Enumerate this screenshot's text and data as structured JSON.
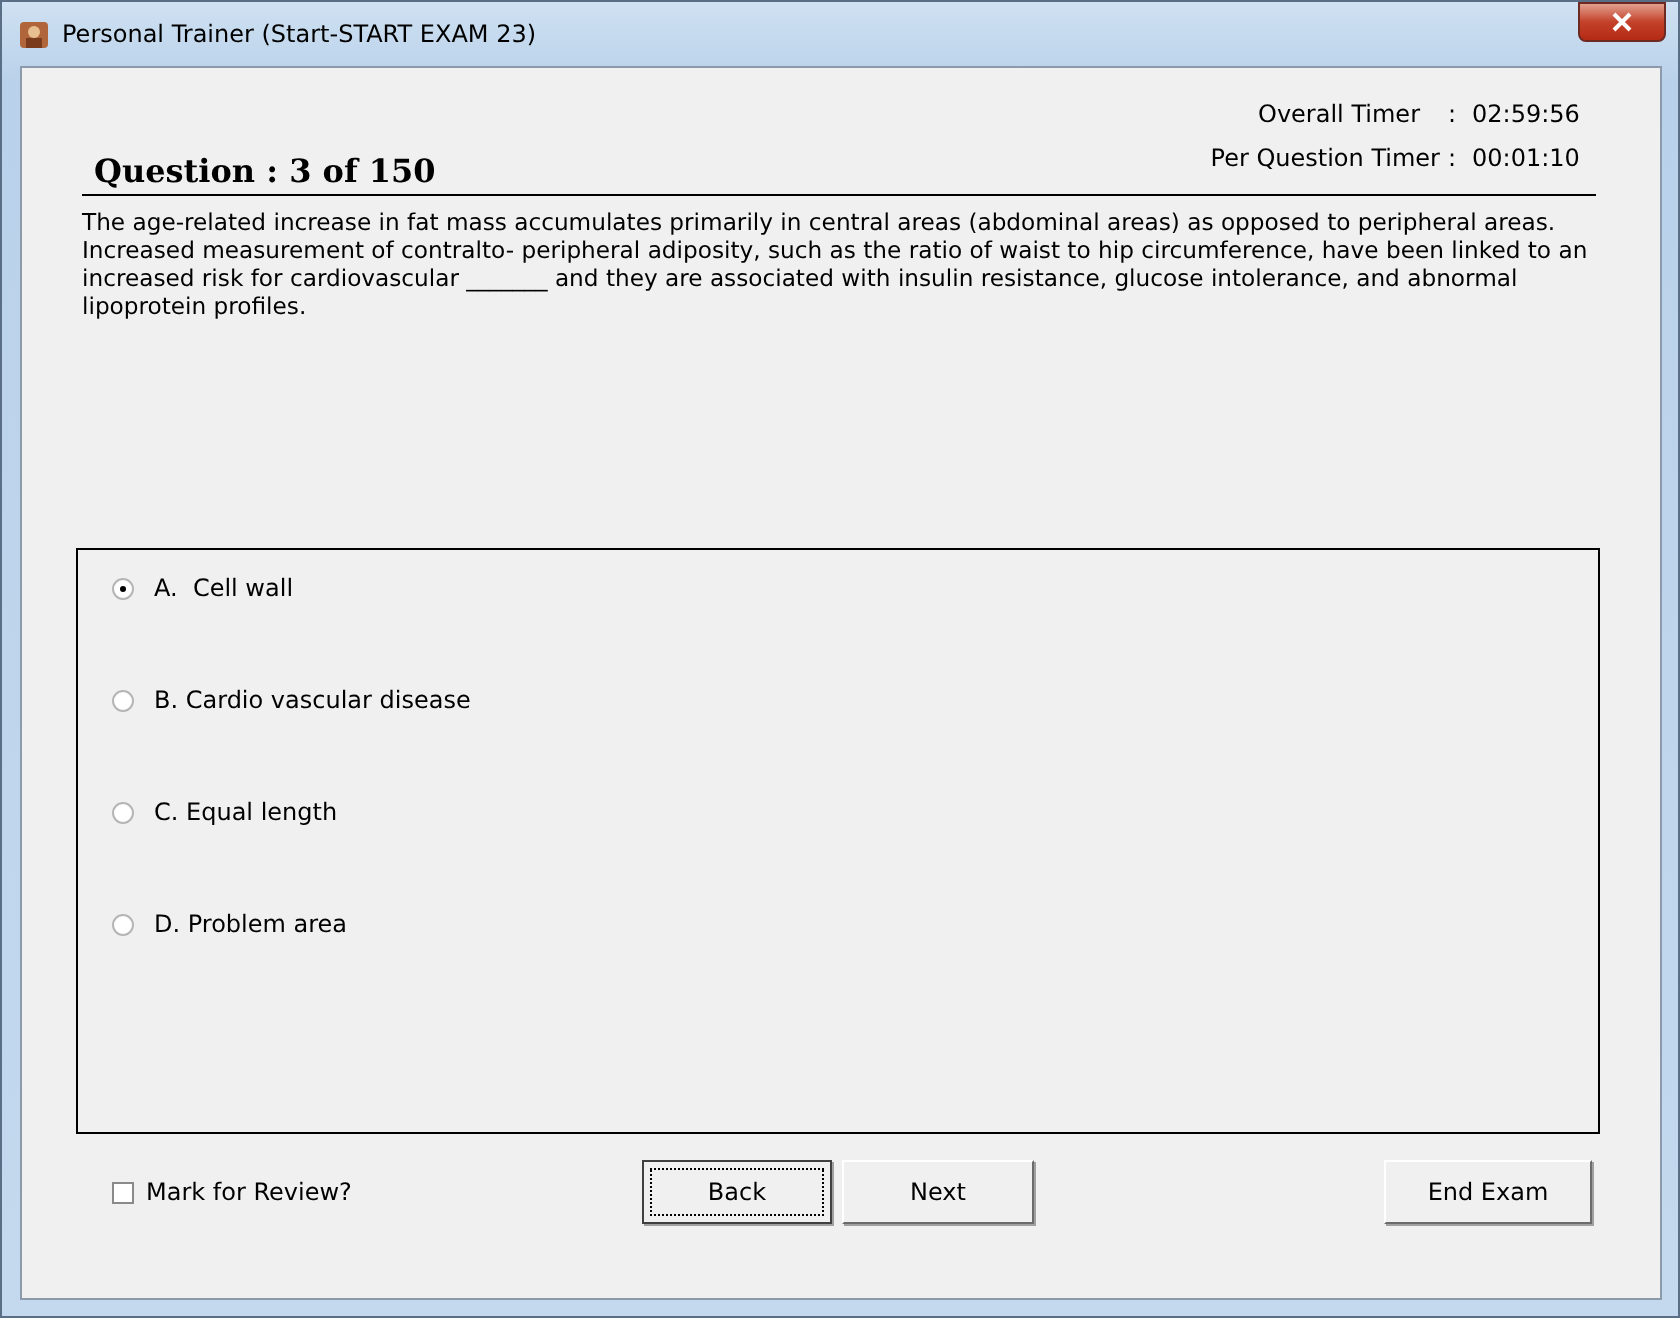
{
  "window": {
    "title": "Personal Trainer (Start-START EXAM 23)"
  },
  "timers": [
    {
      "label": "Overall Timer",
      "sep": ":",
      "value": "02:59:56"
    },
    {
      "label": "Per Question Timer",
      "sep": ":",
      "value": "00:01:10"
    }
  ],
  "question": {
    "heading": "Question : 3 of 150",
    "text": "The age-related increase in fat mass accumulates primarily in central areas (abdominal areas) as opposed to peripheral areas. Increased measurement of contralto- peripheral adiposity, such as the ratio of waist to hip circumference, have been linked to an increased risk for cardiovascular _______ and they are associated with insulin resistance, glucose intolerance, and abnormal lipoprotein profiles."
  },
  "options": [
    {
      "label": "A.  Cell wall",
      "selected": true
    },
    {
      "label": "B. Cardio vascular disease",
      "selected": false
    },
    {
      "label": "C. Equal length",
      "selected": false
    },
    {
      "label": "D. Problem area",
      "selected": false
    }
  ],
  "review": {
    "label": "Mark for Review?",
    "checked": false
  },
  "buttons": [
    {
      "label": "Back",
      "focused": true
    },
    {
      "label": "Next",
      "focused": false
    },
    {
      "label": "End Exam",
      "focused": false
    }
  ]
}
